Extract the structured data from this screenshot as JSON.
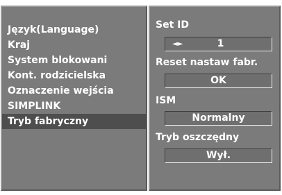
{
  "menu": {
    "items": [
      {
        "label": "Język(Language)"
      },
      {
        "label": "Kraj"
      },
      {
        "label": "System blokowani"
      },
      {
        "label": "Kont. rodzicielska"
      },
      {
        "label": "Oznaczenie wejścia"
      },
      {
        "label": "SIMPLINK"
      },
      {
        "label": "Tryb fabryczny"
      }
    ],
    "selected": "Tryb fabryczny"
  },
  "settings": {
    "set_id": {
      "label": "Set ID",
      "arrows": "◄►",
      "value": "1"
    },
    "reset": {
      "label": "Reset nastaw fabr.",
      "button": "OK"
    },
    "ism": {
      "label": "ISM",
      "value": "Normalny"
    },
    "power_save": {
      "label": "Tryb oszczędny",
      "value": "Wył."
    }
  },
  "colors": {
    "panel": "#7b7b7b",
    "selected_row": "#4e4e4e",
    "text": "#ffffff"
  }
}
